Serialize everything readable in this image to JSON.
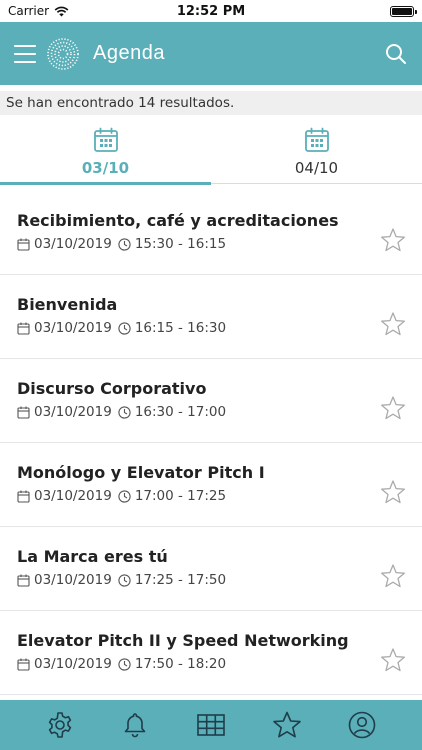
{
  "status_bar": {
    "carrier": "Carrier",
    "time": "12:52 PM",
    "wifi_icon": "wifi-icon",
    "battery_icon": "battery-icon"
  },
  "header": {
    "title": "Agenda",
    "menu_icon": "hamburger-menu-icon",
    "logo_icon": "dotted-circle-logo-icon",
    "search_icon": "search-icon",
    "background_color": "#5aafb8"
  },
  "results": {
    "text": "Se han encontrado 14 resultados."
  },
  "tabs": [
    {
      "label": "03/10",
      "icon": "calendar-icon",
      "active": true
    },
    {
      "label": "04/10",
      "icon": "calendar-icon",
      "active": false
    }
  ],
  "sessions": [
    {
      "title": "Recibimiento, café y acreditaciones",
      "date": "03/10/2019",
      "time": "15:30 - 16:15"
    },
    {
      "title": "Bienvenida",
      "date": "03/10/2019",
      "time": "16:15 - 16:30"
    },
    {
      "title": "Discurso Corporativo",
      "date": "03/10/2019",
      "time": "16:30 - 17:00"
    },
    {
      "title": "Monólogo y Elevator Pitch I",
      "date": "03/10/2019",
      "time": "17:00 - 17:25"
    },
    {
      "title": "La Marca eres tú",
      "date": "03/10/2019",
      "time": "17:25 - 17:50"
    },
    {
      "title": "Elevator Pitch II y Speed Networking",
      "date": "03/10/2019",
      "time": "17:50 - 18:20"
    }
  ],
  "bottom_nav": [
    {
      "icon": "gear-icon"
    },
    {
      "icon": "bell-icon"
    },
    {
      "icon": "grid-icon"
    },
    {
      "icon": "star-icon"
    },
    {
      "icon": "user-circle-icon"
    }
  ],
  "colors": {
    "accent": "#5aafb8",
    "results_background": "#efefef"
  }
}
